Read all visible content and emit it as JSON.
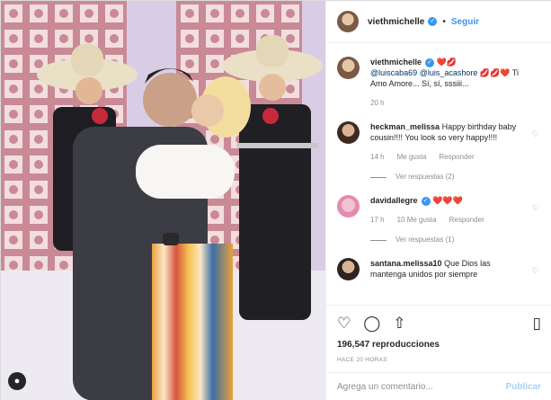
{
  "header": {
    "username": "viethmichelle",
    "verified_icon": "verified-badge-icon",
    "separator": "•",
    "follow": "Seguir"
  },
  "caption": {
    "username": "viethmichelle",
    "text_pre": " ❤️💋 ",
    "mention1": "@luiscaba69",
    "mention2": "@luis_acashore",
    "text_post": " 💋💋❤️ Ti Amo Amore... Sí, sí, sssiii...",
    "time": "20 h"
  },
  "comments": [
    {
      "username": "heckman_melissa",
      "text": "Happy birthday baby cousin!!!! You look so very happy!!!!",
      "time": "14 h",
      "likes": "Me gusta",
      "reply": "Responder",
      "replies": "Ver respuestas (2)"
    },
    {
      "username": "davidallegre",
      "text": "❤️❤️❤️",
      "time": "17 h",
      "likes": "10 Me gusta",
      "reply": "Responder",
      "replies": "Ver respuestas (1)"
    },
    {
      "username": "santana.melissa10",
      "text": "Que Dios las mantenga unidos por siempre"
    }
  ],
  "actions": {
    "like_icon": "heart-icon",
    "comment_icon": "comment-icon",
    "share_icon": "share-icon",
    "save_icon": "bookmark-icon"
  },
  "views": {
    "count": "196,547",
    "label": "reproducciones"
  },
  "posted": "HACE 20 HORAS",
  "comment_box": {
    "placeholder": "Agrega un comentario...",
    "submit": "Publicar"
  }
}
